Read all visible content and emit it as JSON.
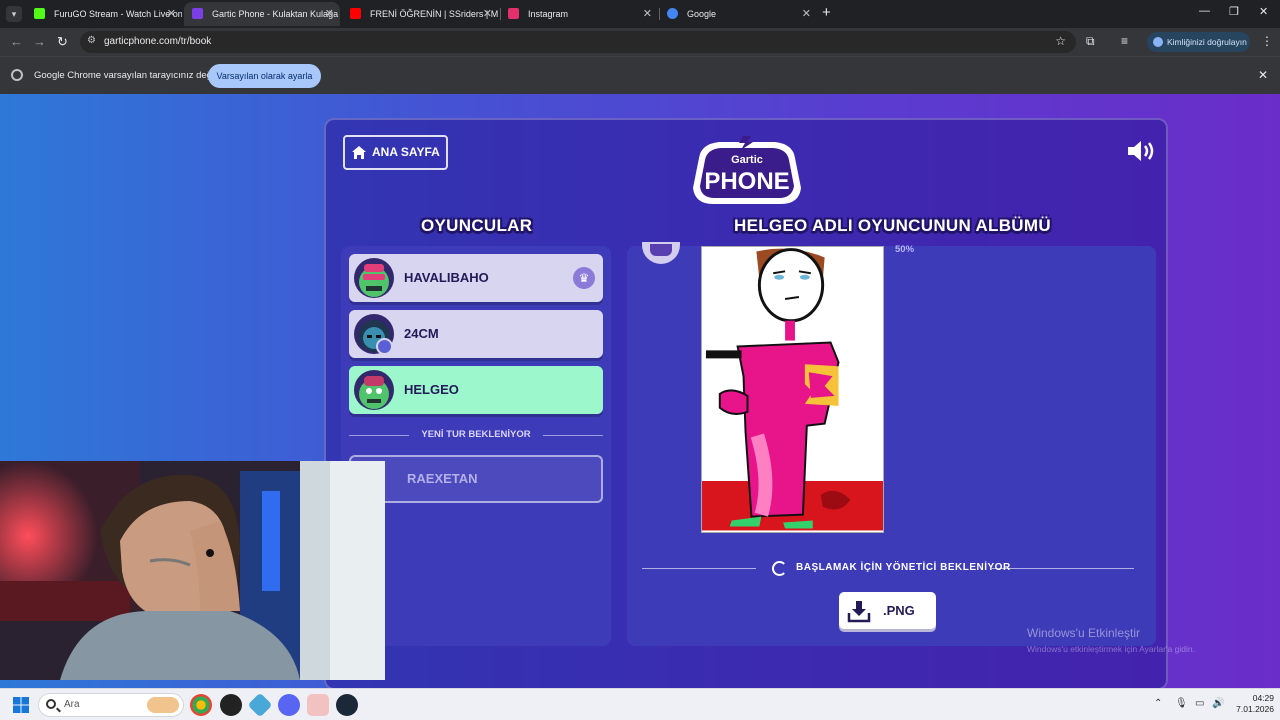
{
  "browser": {
    "tabs": [
      {
        "title": "FuruGO Stream - Watch Live on",
        "favicon_color": "#53fc18",
        "active": false
      },
      {
        "title": "Gartic Phone - Kulaktan Kulağa",
        "favicon_color": "#7b3fe4",
        "active": true
      },
      {
        "title": "FRENİ ÖĞRENİN | SSriders | Me",
        "favicon_color": "#ff0000",
        "active": false
      },
      {
        "title": "Instagram",
        "favicon_color": "#e1306c",
        "active": false
      },
      {
        "title": "Google",
        "favicon_color": "#4285f4",
        "active": false
      }
    ],
    "url": "garticphone.com/tr/book",
    "verify_label": "Kimliğinizi doğrulayın",
    "infobar": {
      "message": "Google Chrome varsayılan tarayıcınız değil",
      "button": "Varsayılan olarak ayarla"
    }
  },
  "game": {
    "home_button": "ANA SAYFA",
    "logo": {
      "top": "Gartic",
      "bottom": "PHONE"
    },
    "players_heading": "OYUNCULAR",
    "album_heading": "HELGEO ADLI OYUNCUNUN ALBÜMÜ",
    "players": [
      {
        "name": "HAVALIBAHO",
        "host": true,
        "me": false
      },
      {
        "name": "24CM",
        "host": false,
        "me": false
      },
      {
        "name": "HELGEO",
        "host": false,
        "me": true
      }
    ],
    "waiting_label": "YENİ TUR BEKLENİYOR",
    "waiting_player": "RAEXETAN",
    "progress_label": "50%",
    "start_status": "BAŞLAMAK İÇİN YÖNETİCİ BEKLENİYOR",
    "download_button": ".PNG"
  },
  "windows": {
    "activation_title": "Windows'u Etkinleştir",
    "activation_sub": "Windows'u etkinleştirmek için Ayarlar'a gidin.",
    "search_label": "Ara",
    "time": "04:29",
    "date": "7.01.2026"
  }
}
